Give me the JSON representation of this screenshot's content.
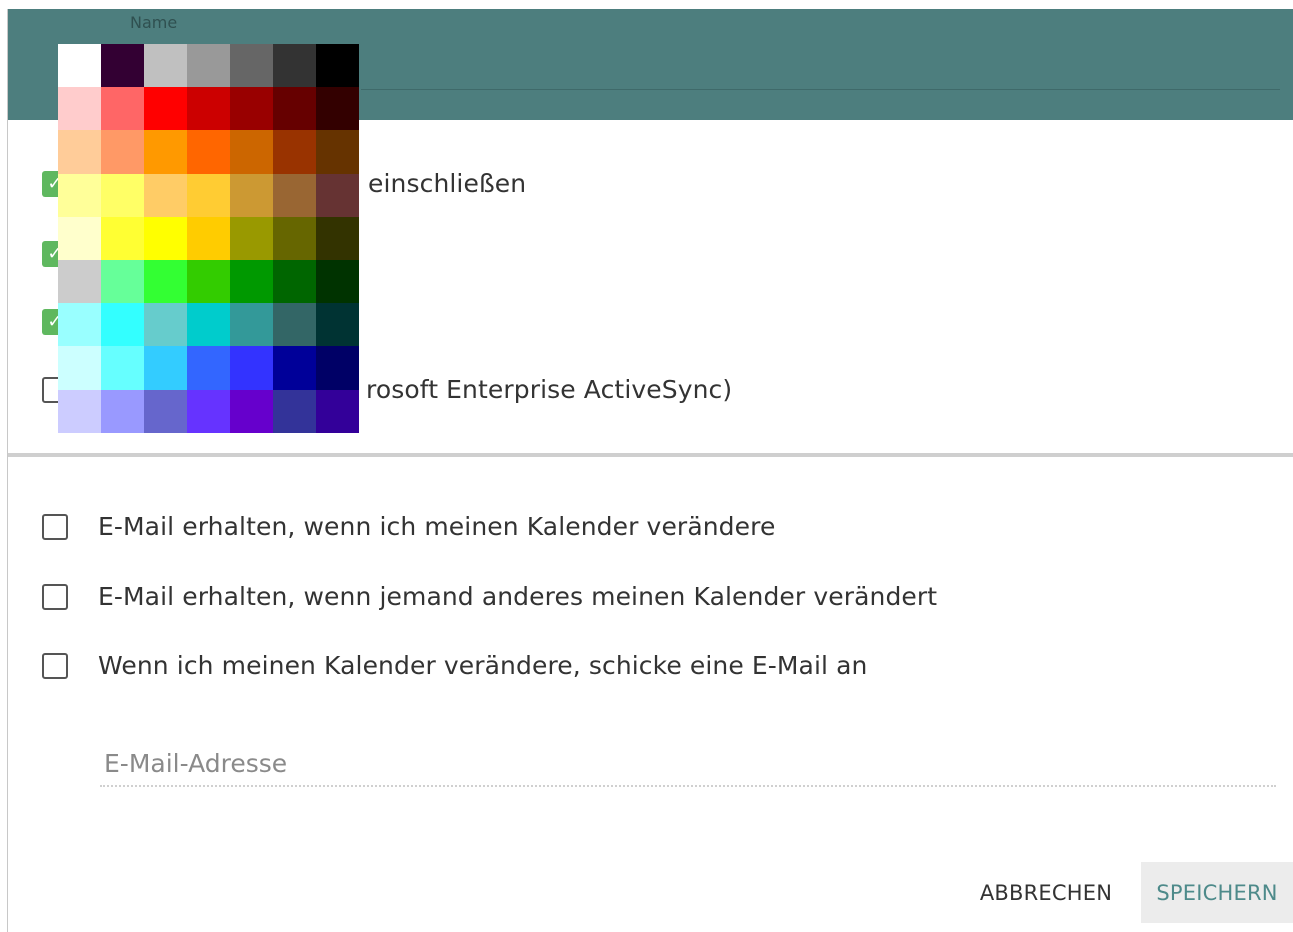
{
  "header": {
    "name_label": "Name",
    "bg_color": "#4d7e7e"
  },
  "options_top": [
    {
      "checked": true,
      "label": "einschließen"
    },
    {
      "checked": true,
      "label": ""
    },
    {
      "checked": true,
      "label": ""
    },
    {
      "checked": false,
      "label": "rosoft Enterprise ActiveSync)"
    }
  ],
  "notifications": [
    {
      "checked": false,
      "label": "E-Mail erhalten, wenn ich meinen Kalender verändere"
    },
    {
      "checked": false,
      "label": "E-Mail erhalten, wenn jemand anderes meinen Kalender verändert"
    },
    {
      "checked": false,
      "label": "Wenn ich meinen Kalender verändere, schicke eine E-Mail an"
    }
  ],
  "email_field": {
    "placeholder": "E-Mail-Adresse",
    "value": ""
  },
  "buttons": {
    "cancel": "ABBRECHEN",
    "save": "SPEICHERN"
  },
  "palette": [
    [
      "#ffffff",
      "#330033",
      "#c0c0c0",
      "#999999",
      "#666666",
      "#333333",
      "#000000"
    ],
    [
      "#ffcccc",
      "#ff6666",
      "#ff0000",
      "#cc0000",
      "#990000",
      "#660000",
      "#330000"
    ],
    [
      "#ffcc99",
      "#ff9966",
      "#ff9900",
      "#ff6600",
      "#cc6600",
      "#993300",
      "#663300"
    ],
    [
      "#ffff99",
      "#ffff66",
      "#ffcc66",
      "#ffcc33",
      "#cc9933",
      "#996633",
      "#663333"
    ],
    [
      "#ffffcc",
      "#ffff33",
      "#ffff00",
      "#ffcc00",
      "#999900",
      "#666600",
      "#333300"
    ],
    [
      "#cccccc",
      "#66ff99",
      "#33ff33",
      "#33cc00",
      "#009900",
      "#006600",
      "#003300"
    ],
    [
      "#99ffff",
      "#33ffff",
      "#66cccc",
      "#00cccc",
      "#339999",
      "#336666",
      "#003333"
    ],
    [
      "#ccffff",
      "#66ffff",
      "#33ccff",
      "#3366ff",
      "#3333ff",
      "#000099",
      "#000066"
    ],
    [
      "#ccccff",
      "#9999ff",
      "#6666cc",
      "#6633ff",
      "#6600cc",
      "#333399",
      "#330099"
    ]
  ]
}
